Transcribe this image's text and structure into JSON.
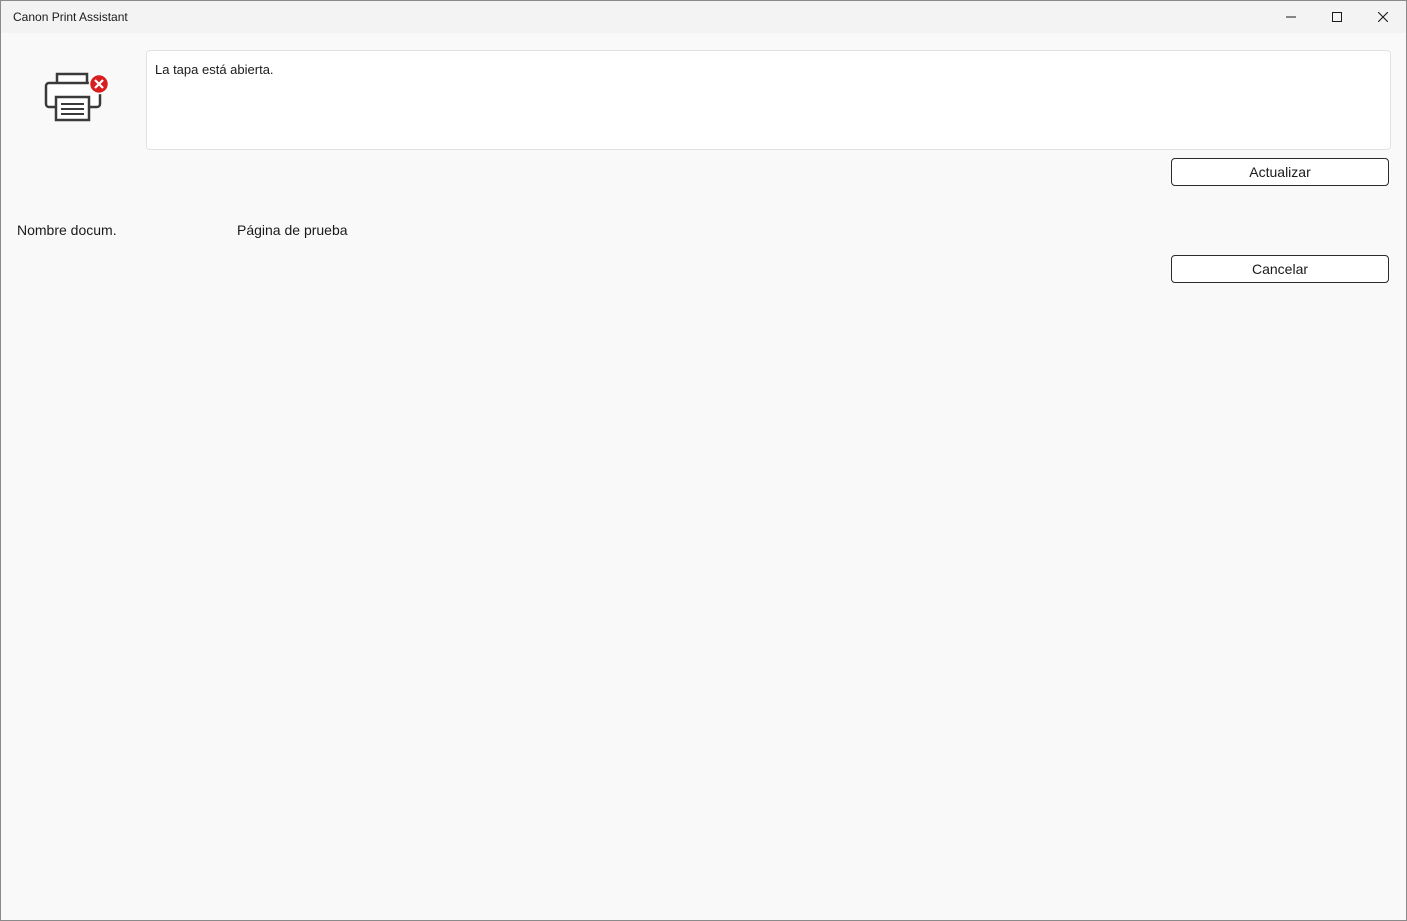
{
  "window": {
    "title": "Canon Print Assistant"
  },
  "status": {
    "icon": "printer-error-icon",
    "message": "La tapa está abierta."
  },
  "buttons": {
    "refresh_label": "Actualizar",
    "cancel_label": "Cancelar"
  },
  "document": {
    "label": "Nombre docum.",
    "value": "Página de prueba"
  },
  "colors": {
    "error_badge": "#d81e1e",
    "window_bg": "#f9f9f9",
    "titlebar_bg": "#f3f3f3"
  }
}
